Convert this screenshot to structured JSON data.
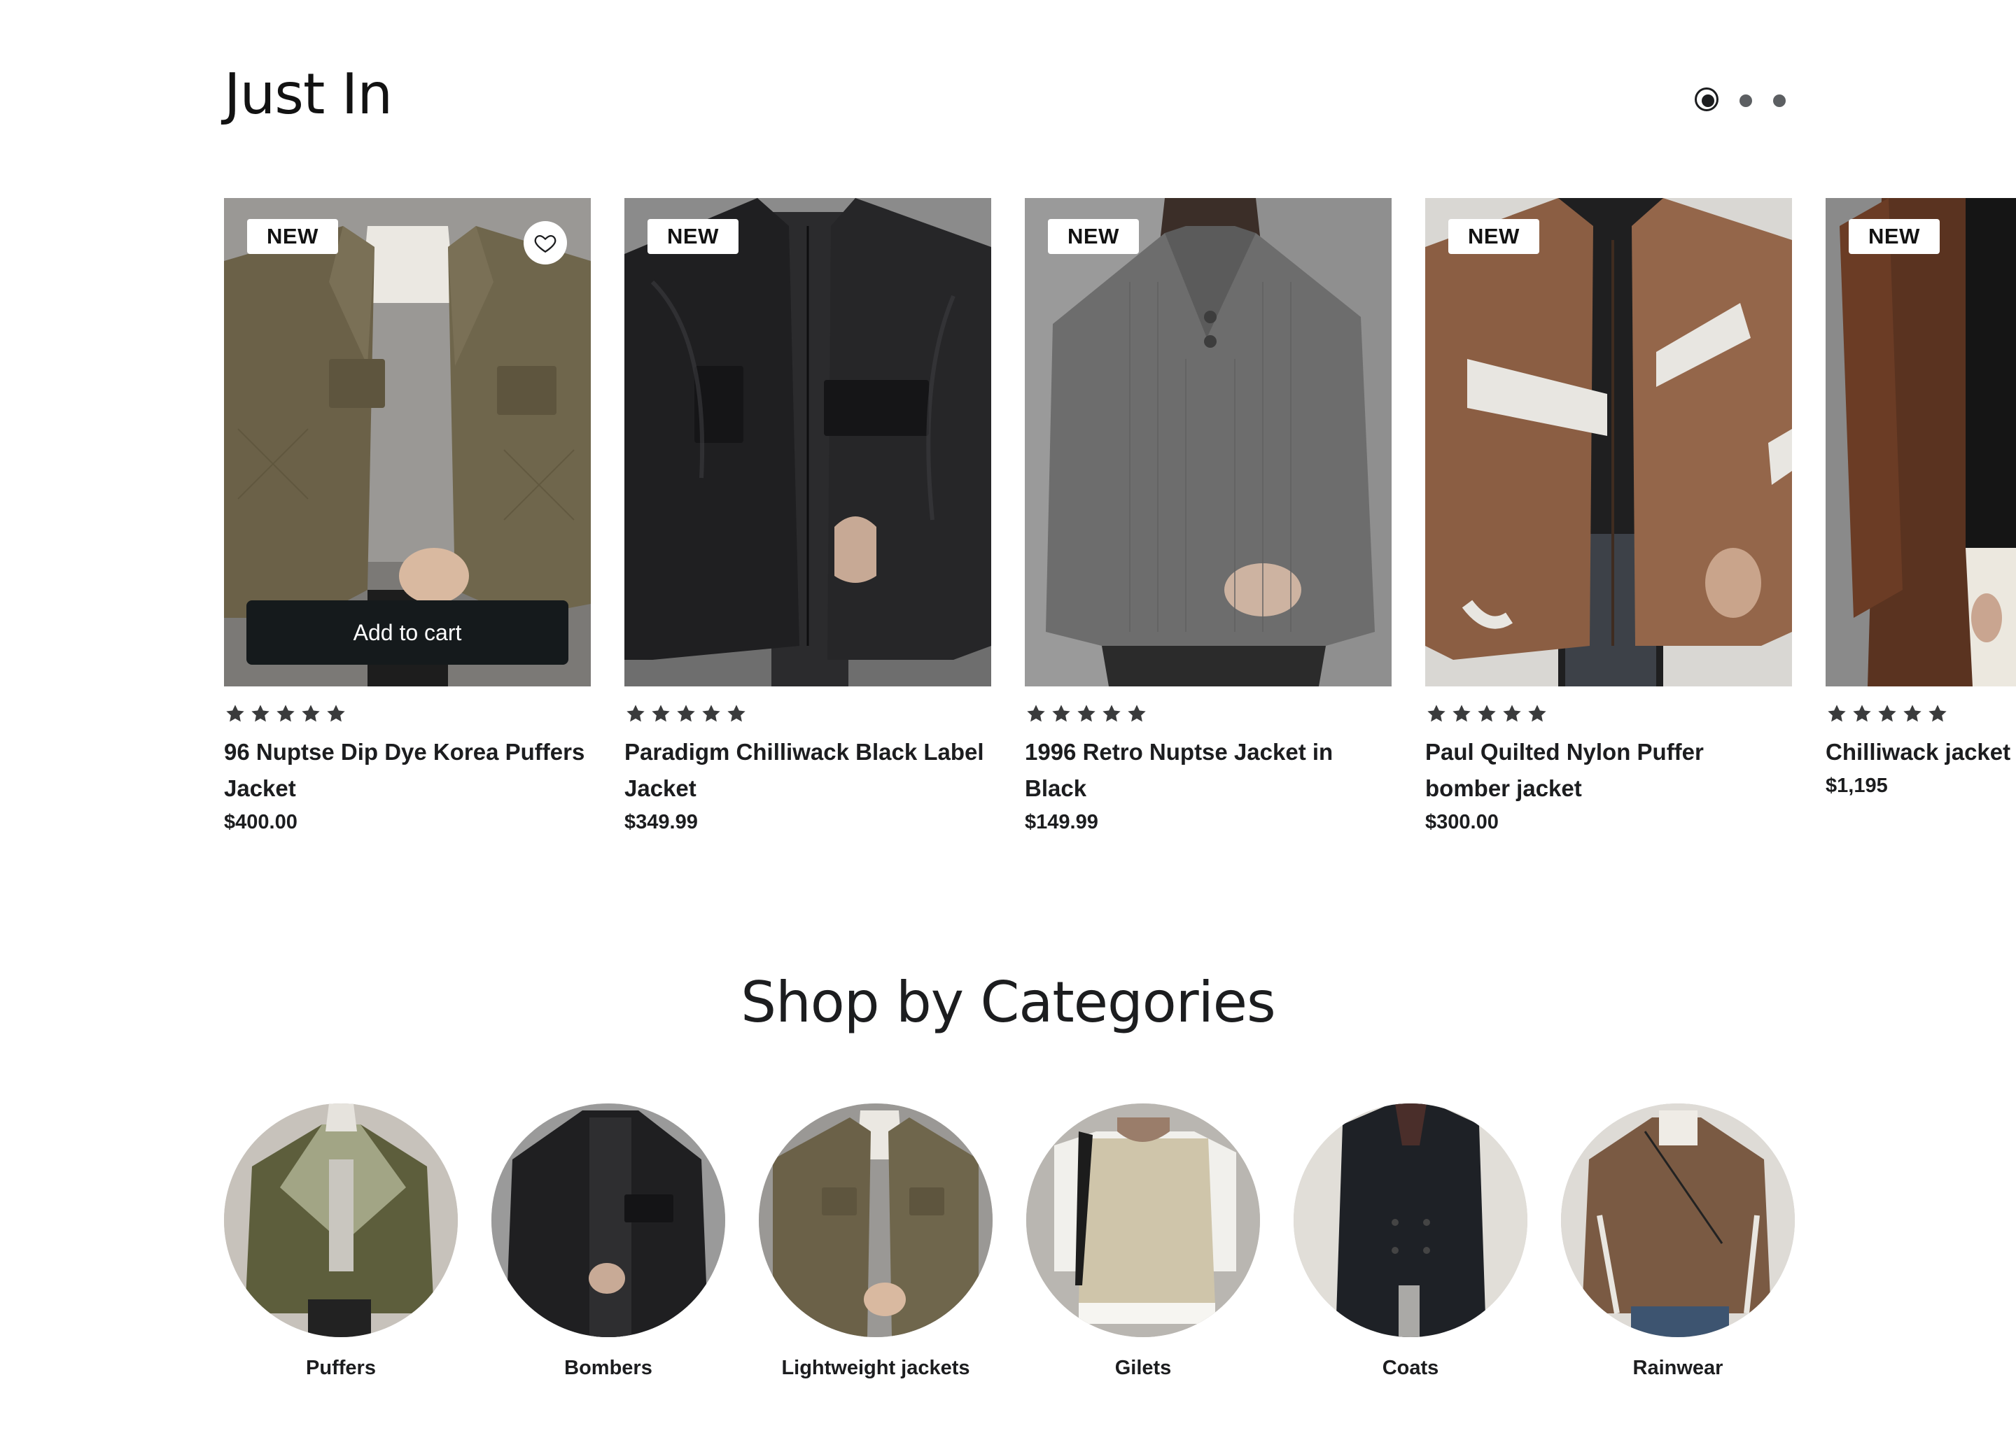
{
  "just_in": {
    "title": "Just In",
    "pager": {
      "pages": 3,
      "active": 1
    }
  },
  "products": [
    {
      "badge": "NEW",
      "name": "96 Nuptse Dip Dye Korea Puffers Jacket",
      "price": "$400.00",
      "rating": 5,
      "add_to_cart": "Add to cart",
      "image": "olive-quilted-jacket"
    },
    {
      "badge": "NEW",
      "name": "Paradigm Chilliwack Black Label Jacket",
      "price": "$349.99",
      "rating": 5,
      "image": "black-leather-jacket"
    },
    {
      "badge": "NEW",
      "name": "1996 Retro Nuptse Jacket in Black",
      "price": "$149.99",
      "rating": 5,
      "image": "grey-knit-sweater"
    },
    {
      "badge": "NEW",
      "name": "Paul Quilted Nylon Puffer bomber jacket",
      "price": "$300.00",
      "rating": 5,
      "image": "brown-stripe-bomber"
    },
    {
      "badge": "NEW",
      "name": "Chilliwack jacket HUMANATURE",
      "price": "$1,195",
      "rating": 5,
      "image": "brown-cardigan"
    }
  ],
  "categories": {
    "title": "Shop by Categories",
    "items": [
      {
        "label": "Puffers",
        "image": "olive-colorblock-jacket"
      },
      {
        "label": "Bombers",
        "image": "black-leather-jacket"
      },
      {
        "label": "Lightweight jackets",
        "image": "olive-quilted-jacket"
      },
      {
        "label": "Gilets",
        "image": "beige-knit-vest"
      },
      {
        "label": "Coats",
        "image": "black-trench-coat"
      },
      {
        "label": "Rainwear",
        "image": "brown-track-jacket"
      }
    ]
  },
  "colors": {
    "text": "#1c1d1f",
    "button": "#151a1c",
    "star": "#3a3b3c"
  }
}
